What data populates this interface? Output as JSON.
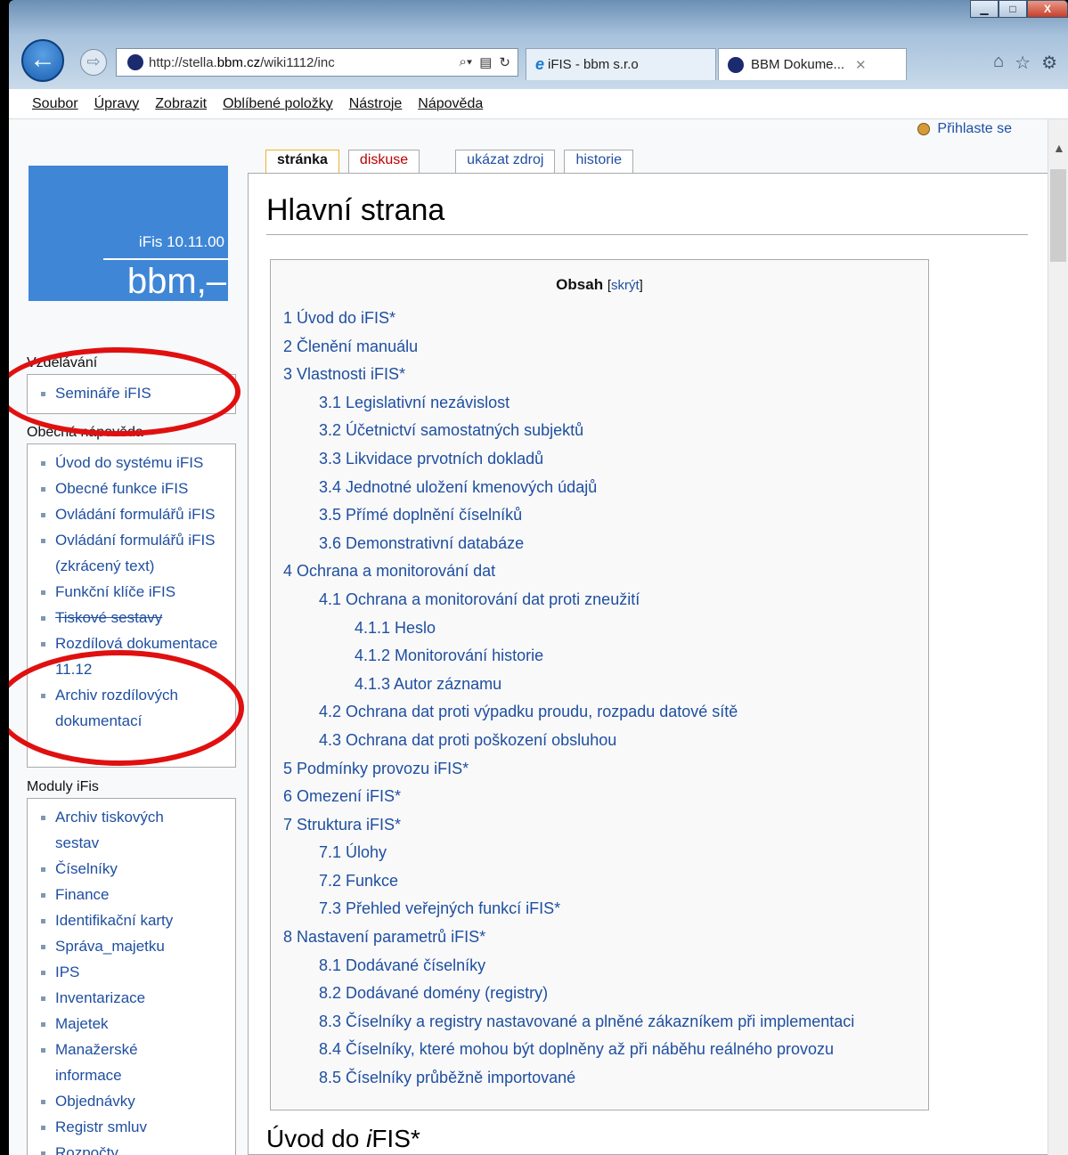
{
  "browser": {
    "address": {
      "prefix": "http://stella.",
      "host": "bbm.cz",
      "path": "/wiki1112/inc"
    },
    "tabs": [
      {
        "title": "iFIS - bbm s.r.o"
      },
      {
        "title": "BBM Dokume..."
      }
    ],
    "window_buttons": {
      "minimize": "▁",
      "maximize": "□",
      "close": "X"
    }
  },
  "menu": [
    "Soubor",
    "Úpravy",
    "Zobrazit",
    "Oblíbené položky",
    "Nástroje",
    "Nápověda"
  ],
  "login": "Přihlaste se",
  "logo": {
    "version": "iFis 10.11.00",
    "name": "bbm,–"
  },
  "sidebar": {
    "sections": [
      {
        "title": "Vzdělávání",
        "items": [
          "Semináře iFIS"
        ]
      },
      {
        "title": "Obecná nápověda",
        "items": [
          "Úvod do systému iFIS",
          "Obecné funkce iFIS",
          "Ovládání formulářů iFIS",
          "Ovládání formulářů iFIS (zkrácený text)",
          "Funkční klíče iFIS",
          "Tiskové sestavy",
          "Rozdílová dokumentace 11.12",
          "Archiv rozdílových dokumentací"
        ]
      },
      {
        "title": "Moduly iFis",
        "items": [
          "Archiv tiskových sestav",
          "Číselníky",
          "Finance",
          "Identifikační karty",
          "Správa_majetku",
          "IPS",
          "Inventarizace",
          "Majetek",
          "Manažerské informace",
          "Objednávky",
          "Registr smluv",
          "Rozpočty"
        ]
      }
    ]
  },
  "page_tabs": [
    "stránka",
    "diskuse",
    "ukázat zdroj",
    "historie"
  ],
  "heading": "Hlavní strana",
  "toc": {
    "title": "Obsah",
    "hide": "skrýt",
    "entries": [
      "1 Úvod do iFIS*",
      "2 Členění manuálu",
      "3 Vlastnosti iFIS*",
      "3.1 Legislativní nezávislost",
      "3.2 Účetnictví samostatných subjektů",
      "3.3 Likvidace prvotních dokladů",
      "3.4 Jednotné uložení kmenových údajů",
      "3.5 Přímé doplnění číselníků",
      "3.6 Demonstrativní databáze",
      "4 Ochrana a monitorování dat",
      "4.1 Ochrana a monitorování dat proti zneužití",
      "4.1.1 Heslo",
      "4.1.2 Monitorování historie",
      "4.1.3 Autor záznamu",
      "4.2 Ochrana dat proti výpadku proudu, rozpadu datové sítě",
      "4.3 Ochrana dat proti poškození obsluhou",
      "5 Podmínky provozu iFIS*",
      "6 Omezení iFIS*",
      "7 Struktura iFIS*",
      "7.1 Úlohy",
      "7.2 Funkce",
      "7.3 Přehled veřejných funkcí iFIS*",
      "8 Nastavení parametrů iFIS*",
      "8.1 Dodávané číselníky",
      "8.2 Dodávané domény (registry)",
      "8.3 Číselníky a registry nastavované a plněné zákazníkem při implementaci",
      "8.4 Číselníky, které mohou být doplněny až při náběhu reálného provozu",
      "8.5 Číselníky průběžně importované"
    ]
  },
  "section_heading": {
    "before": "Úvod do ",
    "italic": "i",
    "after": "FIS*"
  },
  "colors": {
    "link": "#1f4fa0",
    "logo_bg": "#3f86d6",
    "annotation": "#e01010",
    "selected_tab_border": "#f0b030"
  }
}
